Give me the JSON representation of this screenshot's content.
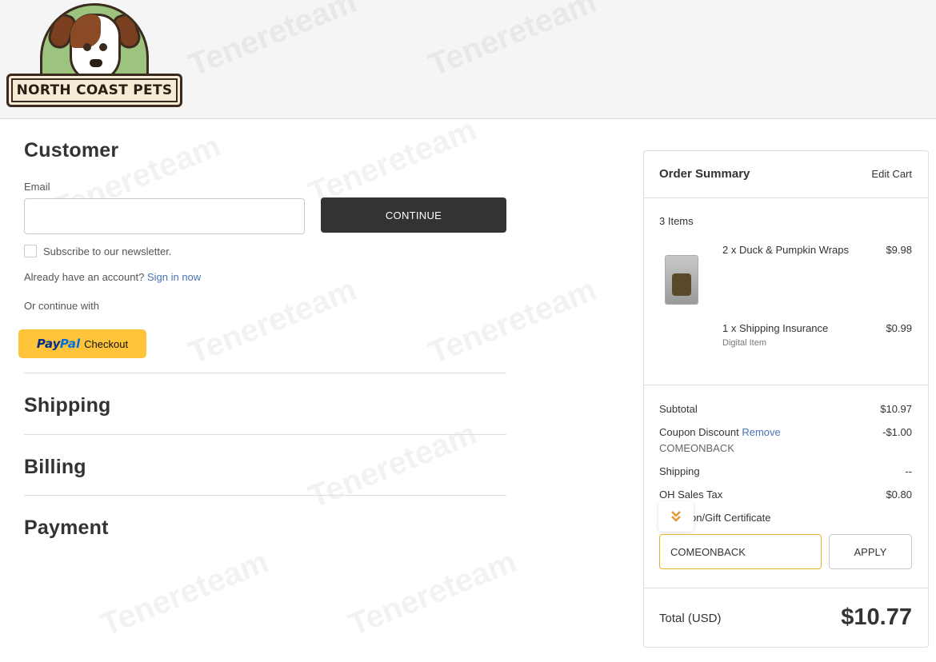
{
  "header": {
    "brand": "NORTH COAST PETS"
  },
  "customer": {
    "title": "Customer",
    "email_label": "Email",
    "email_value": "",
    "continue_label": "CONTINUE",
    "newsletter_label": "Subscribe to our newsletter.",
    "account_prompt": "Already have an account?",
    "sign_in_label": "Sign in now",
    "continue_with": "Or continue with",
    "paypal_brand_1": "Pay",
    "paypal_brand_2": "Pal",
    "paypal_checkout": "Checkout"
  },
  "steps": {
    "shipping": "Shipping",
    "billing": "Billing",
    "payment": "Payment"
  },
  "summary": {
    "title": "Order Summary",
    "edit_cart": "Edit Cart",
    "item_count": "3 Items",
    "items": [
      {
        "name": "2 x Duck & Pumpkin Wraps",
        "price": "$9.98",
        "sub": ""
      },
      {
        "name": "1 x Shipping Insurance",
        "price": "$0.99",
        "sub": "Digital Item"
      }
    ],
    "subtotal_label": "Subtotal",
    "subtotal_value": "$10.97",
    "coupon_label": "Coupon Discount",
    "coupon_remove": "Remove",
    "coupon_code": "COMEONBACK",
    "coupon_value": "-$1.00",
    "shipping_label": "Shipping",
    "shipping_value": "--",
    "tax_label": "OH Sales Tax",
    "tax_value": "$0.80",
    "gift_link": "on/Gift Certificate",
    "coupon_input_value": "COMEONBACK",
    "apply_label": "APPLY",
    "total_label": "Total (USD)",
    "total_value": "$10.77"
  },
  "watermark": "Tenereteam",
  "colors": {
    "link": "#4b71b5",
    "dark_button": "#333333",
    "paypal_yellow": "#ffc439",
    "coupon_border": "#e0b422"
  }
}
